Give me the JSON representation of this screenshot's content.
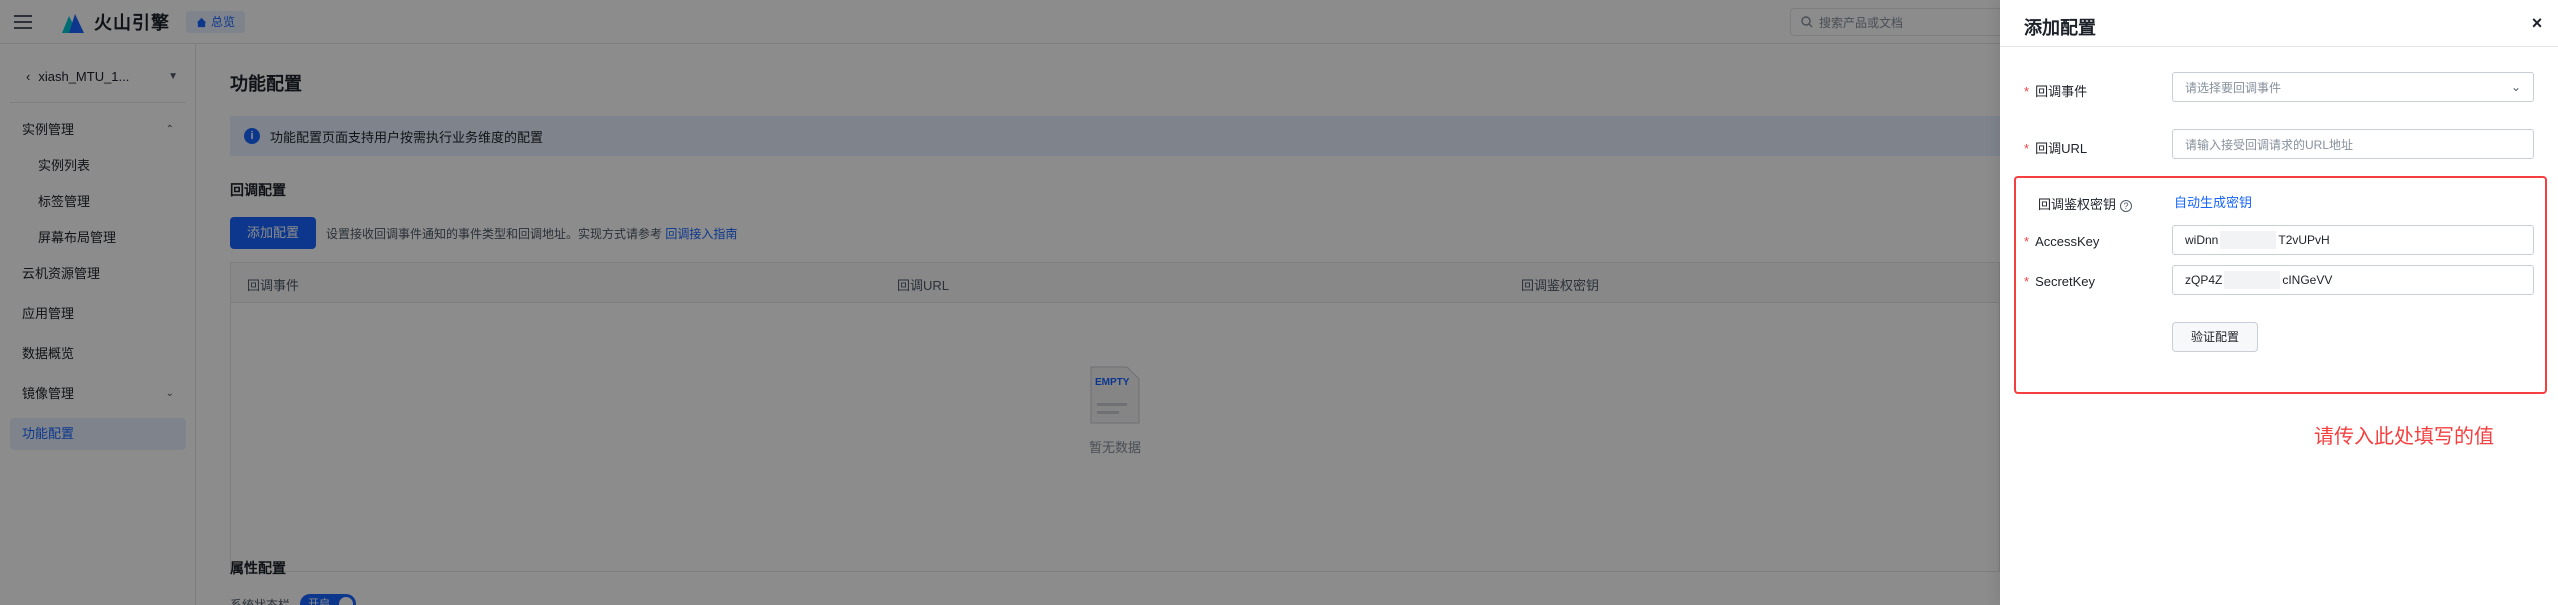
{
  "header": {
    "brand": "火山引擎",
    "home_chip": "总览",
    "search_placeholder": "搜索产品或文档"
  },
  "sidebar": {
    "instance": "xiash_MTU_1...",
    "items": [
      {
        "label": "实例管理",
        "chevron": "^"
      },
      {
        "label": "实例列表"
      },
      {
        "label": "标签管理"
      },
      {
        "label": "屏幕布局管理"
      },
      {
        "label": "云机资源管理"
      },
      {
        "label": "应用管理"
      },
      {
        "label": "数据概览"
      },
      {
        "label": "镜像管理",
        "chevron": "v"
      },
      {
        "label": "功能配置"
      }
    ]
  },
  "main": {
    "title": "功能配置",
    "banner": "功能配置页面支持用户按需执行业务维度的配置",
    "callback_section": "回调配置",
    "add_button": "添加配置",
    "add_hint": "设置接收回调事件通知的事件类型和回调地址。实现方式请参考",
    "guide_link": "回调接入指南",
    "table_headers": [
      "回调事件",
      "回调URL",
      "回调鉴权密钥"
    ],
    "empty_text": "暂无数据",
    "empty_badge": "EMPTY",
    "attr_section": "属性配置",
    "attr_label": "系统状态栏",
    "toggle_label": "开启"
  },
  "drawer": {
    "title": "添加配置",
    "close": "×",
    "event_label": "回调事件",
    "event_placeholder": "请选择要回调事件",
    "url_label": "回调URL",
    "url_placeholder": "请输入接受回调请求的URL地址",
    "auth_label": "回调鉴权密钥",
    "auth_link": "自动生成密钥",
    "ak_label": "AccessKey",
    "ak_prefix": "wiDnn",
    "ak_suffix": "T2vUPvH",
    "sk_label": "SecretKey",
    "sk_prefix": "zQP4Z",
    "sk_suffix": "cINGeVV",
    "verify_button": "验证配置",
    "annotation": "请传入此处填写的值"
  },
  "colors": {
    "accent": "#1664ff",
    "required": "#f53f3f",
    "highlight_frame": "#f53f3f"
  },
  "icons": [
    "hamburger-icon",
    "logo-icon",
    "home-icon",
    "search-icon",
    "back-chevron-icon",
    "info-icon",
    "close-icon",
    "chevron-down-icon",
    "help-icon",
    "empty-illustration-icon"
  ]
}
